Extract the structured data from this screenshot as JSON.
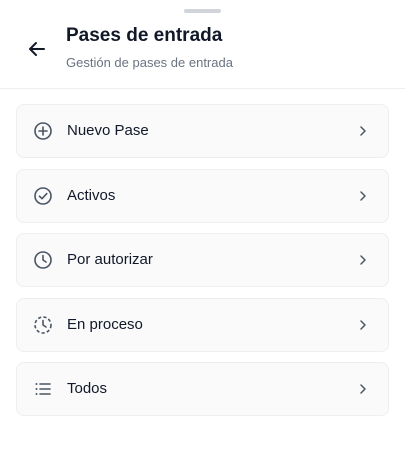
{
  "header": {
    "title": "Pases de entrada",
    "subtitle": "Gestión de pases de entrada",
    "back_icon": "arrow-left-icon"
  },
  "menu": {
    "items": [
      {
        "label": "Nuevo Pase",
        "icon": "plus-circle-icon"
      },
      {
        "label": "Activos",
        "icon": "check-circle-icon"
      },
      {
        "label": "Por autorizar",
        "icon": "clock-icon"
      },
      {
        "label": "En proceso",
        "icon": "clock-dashed-icon"
      },
      {
        "label": "Todos",
        "icon": "list-icon"
      }
    ],
    "chevron_icon": "chevron-right-icon"
  },
  "colors": {
    "text": "#111827",
    "muted": "#6b7280",
    "border": "#eceef1",
    "card": "#fafafb",
    "icon": "#4b5563"
  }
}
